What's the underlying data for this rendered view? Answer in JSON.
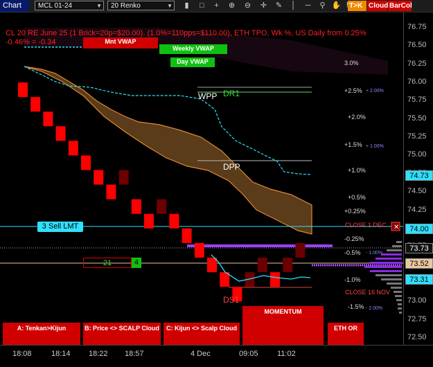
{
  "toolbar": {
    "tab_label": "Chart",
    "instrument": "MCL 01-24",
    "bar_type": "20 Renko",
    "buttons": [
      "bar-chart-icon",
      "window-icon",
      "crosshair-icon",
      "zoom-in-icon",
      "zoom-out-icon",
      "plus-icon",
      "pencil-icon",
      "vertical-line-icon",
      "horizontal-line-icon",
      "pin-icon",
      "hand-icon",
      "flag-icon"
    ],
    "tag_tk": "T>K",
    "tag_cloud": "Cloud",
    "tag_barcol": "BarCol"
  },
  "header": {
    "line1": "CL 20 RE June 25 (1 Brick=20p=$20.00). (1.0%=110pps=$110.00), ETH TPO, Wk %, US Daily from 0.25%",
    "line2": "-0.46% = -0.34"
  },
  "price_axis": {
    "labels": [
      "76.75",
      "76.50",
      "76.25",
      "76.00",
      "75.75",
      "75.50",
      "75.25",
      "75.00",
      "74.75",
      "74.50",
      "74.25",
      "74.00",
      "73.75",
      "73.50",
      "73.25",
      "73.00",
      "72.75",
      "72.50"
    ],
    "badges": [
      {
        "text": "74.73",
        "color": "#2fe0ff",
        "fg": "#000"
      },
      {
        "text": "74.00",
        "color": "#2fe0ff",
        "fg": "#000"
      },
      {
        "text": "73.73",
        "color": "#111111",
        "fg": "#fff"
      },
      {
        "text": "73.52",
        "color": "#e8c8a0",
        "fg": "#000"
      },
      {
        "text": "73.31",
        "color": "#2fe0ff",
        "fg": "#000"
      }
    ]
  },
  "time_axis": {
    "labels": [
      "18:08",
      "18:14",
      "18:22",
      "18:57",
      "4 Dec",
      "09:05",
      "11:02"
    ]
  },
  "chart_data": {
    "type": "renko",
    "bricks": [
      {
        "dir": "down",
        "top": 76.0,
        "bottom": 75.8
      },
      {
        "dir": "down",
        "top": 75.8,
        "bottom": 75.6
      },
      {
        "dir": "down",
        "top": 75.6,
        "bottom": 75.4
      },
      {
        "dir": "down",
        "top": 75.4,
        "bottom": 75.2
      },
      {
        "dir": "down",
        "top": 75.2,
        "bottom": 75.0
      },
      {
        "dir": "down",
        "top": 75.0,
        "bottom": 74.8
      },
      {
        "dir": "down",
        "top": 74.8,
        "bottom": 74.6
      },
      {
        "dir": "down",
        "top": 74.6,
        "bottom": 74.4
      },
      {
        "dir": "up",
        "top": 74.8,
        "bottom": 74.6
      },
      {
        "dir": "down",
        "top": 74.4,
        "bottom": 74.2
      },
      {
        "dir": "down",
        "top": 74.2,
        "bottom": 74.0
      },
      {
        "dir": "up",
        "top": 74.4,
        "bottom": 74.2
      },
      {
        "dir": "down",
        "top": 74.2,
        "bottom": 74.0
      },
      {
        "dir": "down",
        "top": 74.0,
        "bottom": 73.8
      },
      {
        "dir": "down",
        "top": 73.8,
        "bottom": 73.6
      },
      {
        "dir": "down",
        "top": 73.6,
        "bottom": 73.4
      },
      {
        "dir": "down",
        "top": 73.4,
        "bottom": 73.2
      },
      {
        "dir": "down",
        "top": 73.2,
        "bottom": 73.0
      },
      {
        "dir": "up",
        "top": 73.4,
        "bottom": 73.2
      },
      {
        "dir": "up",
        "top": 73.6,
        "bottom": 73.4
      },
      {
        "dir": "down",
        "top": 73.4,
        "bottom": 73.2
      },
      {
        "dir": "up",
        "top": 73.6,
        "bottom": 73.4
      },
      {
        "dir": "up",
        "top": 73.8,
        "bottom": 73.6
      }
    ],
    "ylim": [
      72.45,
      76.85
    ]
  },
  "levels": {
    "wpp": "WPP",
    "dr1": "DR1",
    "dpp": "DPP",
    "ds1": "DS1",
    "close_dec": "CLOSE 1 DEC",
    "close_nov": "CLOSE 16 NOV",
    "sell_limit": "3 Sell LMT",
    "position_qty": "21",
    "position_num": "4",
    "mnt_vwap": "Mnt VWAP",
    "weekly_vwap": "Weekly VWAP",
    "day_vwap": "Day VWAP"
  },
  "pct_labels": [
    {
      "t": "3.0%"
    },
    {
      "t": "+2.5%"
    },
    {
      "t": "+2.0%"
    },
    {
      "t": "+1.5%"
    },
    {
      "t": "+1.0%"
    },
    {
      "t": "+0.5%"
    },
    {
      "t": "+0.25%"
    },
    {
      "t": "-0.25%"
    },
    {
      "t": "-0.5%"
    },
    {
      "t": "-1.0%"
    },
    {
      "t": "-1.5%"
    },
    {
      "t": "-2.0%"
    }
  ],
  "pct_blue": [
    "+ 2.00%",
    "+ 1.00%",
    "- 1.00%",
    "- 2.00%"
  ],
  "bottom_buttons": {
    "a": "A: Tenkan>Kijun",
    "b": "B: Price <> SCALP Cloud",
    "c": "C: Kijun <> Scalp Cloud",
    "momentum": "MOMENTUM",
    "eth": "ETH OR"
  },
  "colors": {
    "bear": "#ff0000",
    "bear_dim": "#6b0000",
    "cloud": "#c8823a",
    "cyan": "#2fe0ff"
  }
}
